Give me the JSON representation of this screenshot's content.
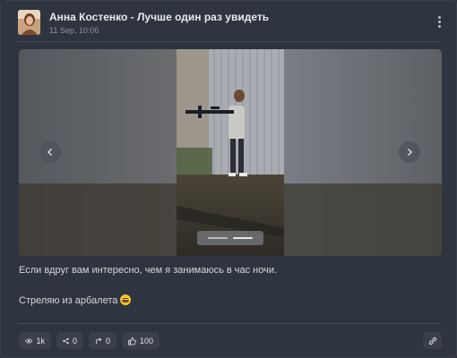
{
  "post": {
    "author": "Анна Костенко",
    "separator": " - ",
    "page_title": "Лучше один раз увидеть",
    "timestamp": "11 Sep, 10:06",
    "text_line_1": "Если вдруг вам интересно, чем я занимаюсь в час ночи.",
    "text_line_2": "Стреляю из арбалета"
  },
  "media": {
    "slide_count": 2,
    "active_slide": 2
  },
  "stats": {
    "views": "1k",
    "shares": "0",
    "reposts": "0",
    "likes": "100"
  },
  "icons": {
    "menu": "vertical-dots-icon",
    "prev": "chevron-left-icon",
    "next": "chevron-right-icon",
    "views": "eye-icon",
    "shares": "share-icon",
    "reposts": "repost-arrow-icon",
    "likes": "thumbs-up-icon",
    "link": "link-icon",
    "emoji": "grinning-face-icon"
  },
  "colors": {
    "background": "#2f3540",
    "pill": "#3a404b",
    "text": "#d3d7dd"
  }
}
